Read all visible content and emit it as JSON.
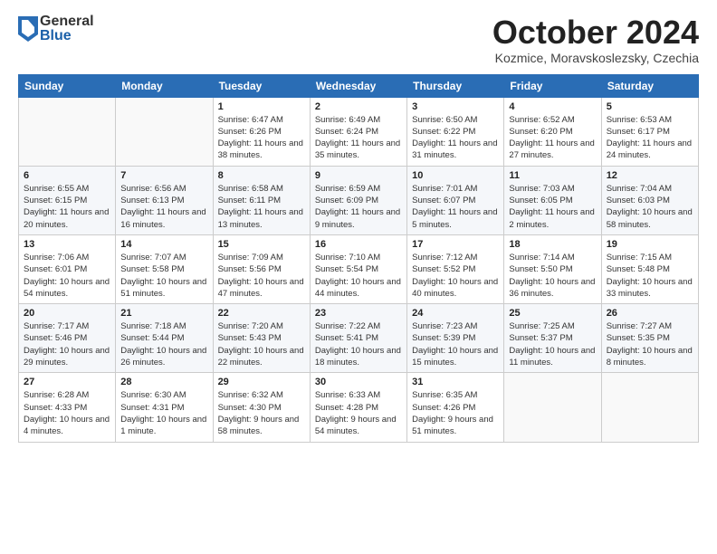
{
  "header": {
    "logo": {
      "general": "General",
      "blue": "Blue"
    },
    "title": "October 2024",
    "location": "Kozmice, Moravskoslezsky, Czechia"
  },
  "weekdays": [
    "Sunday",
    "Monday",
    "Tuesday",
    "Wednesday",
    "Thursday",
    "Friday",
    "Saturday"
  ],
  "weeks": [
    [
      {
        "day": "",
        "detail": ""
      },
      {
        "day": "",
        "detail": ""
      },
      {
        "day": "1",
        "detail": "Sunrise: 6:47 AM\nSunset: 6:26 PM\nDaylight: 11 hours and 38 minutes."
      },
      {
        "day": "2",
        "detail": "Sunrise: 6:49 AM\nSunset: 6:24 PM\nDaylight: 11 hours and 35 minutes."
      },
      {
        "day": "3",
        "detail": "Sunrise: 6:50 AM\nSunset: 6:22 PM\nDaylight: 11 hours and 31 minutes."
      },
      {
        "day": "4",
        "detail": "Sunrise: 6:52 AM\nSunset: 6:20 PM\nDaylight: 11 hours and 27 minutes."
      },
      {
        "day": "5",
        "detail": "Sunrise: 6:53 AM\nSunset: 6:17 PM\nDaylight: 11 hours and 24 minutes."
      }
    ],
    [
      {
        "day": "6",
        "detail": "Sunrise: 6:55 AM\nSunset: 6:15 PM\nDaylight: 11 hours and 20 minutes."
      },
      {
        "day": "7",
        "detail": "Sunrise: 6:56 AM\nSunset: 6:13 PM\nDaylight: 11 hours and 16 minutes."
      },
      {
        "day": "8",
        "detail": "Sunrise: 6:58 AM\nSunset: 6:11 PM\nDaylight: 11 hours and 13 minutes."
      },
      {
        "day": "9",
        "detail": "Sunrise: 6:59 AM\nSunset: 6:09 PM\nDaylight: 11 hours and 9 minutes."
      },
      {
        "day": "10",
        "detail": "Sunrise: 7:01 AM\nSunset: 6:07 PM\nDaylight: 11 hours and 5 minutes."
      },
      {
        "day": "11",
        "detail": "Sunrise: 7:03 AM\nSunset: 6:05 PM\nDaylight: 11 hours and 2 minutes."
      },
      {
        "day": "12",
        "detail": "Sunrise: 7:04 AM\nSunset: 6:03 PM\nDaylight: 10 hours and 58 minutes."
      }
    ],
    [
      {
        "day": "13",
        "detail": "Sunrise: 7:06 AM\nSunset: 6:01 PM\nDaylight: 10 hours and 54 minutes."
      },
      {
        "day": "14",
        "detail": "Sunrise: 7:07 AM\nSunset: 5:58 PM\nDaylight: 10 hours and 51 minutes."
      },
      {
        "day": "15",
        "detail": "Sunrise: 7:09 AM\nSunset: 5:56 PM\nDaylight: 10 hours and 47 minutes."
      },
      {
        "day": "16",
        "detail": "Sunrise: 7:10 AM\nSunset: 5:54 PM\nDaylight: 10 hours and 44 minutes."
      },
      {
        "day": "17",
        "detail": "Sunrise: 7:12 AM\nSunset: 5:52 PM\nDaylight: 10 hours and 40 minutes."
      },
      {
        "day": "18",
        "detail": "Sunrise: 7:14 AM\nSunset: 5:50 PM\nDaylight: 10 hours and 36 minutes."
      },
      {
        "day": "19",
        "detail": "Sunrise: 7:15 AM\nSunset: 5:48 PM\nDaylight: 10 hours and 33 minutes."
      }
    ],
    [
      {
        "day": "20",
        "detail": "Sunrise: 7:17 AM\nSunset: 5:46 PM\nDaylight: 10 hours and 29 minutes."
      },
      {
        "day": "21",
        "detail": "Sunrise: 7:18 AM\nSunset: 5:44 PM\nDaylight: 10 hours and 26 minutes."
      },
      {
        "day": "22",
        "detail": "Sunrise: 7:20 AM\nSunset: 5:43 PM\nDaylight: 10 hours and 22 minutes."
      },
      {
        "day": "23",
        "detail": "Sunrise: 7:22 AM\nSunset: 5:41 PM\nDaylight: 10 hours and 18 minutes."
      },
      {
        "day": "24",
        "detail": "Sunrise: 7:23 AM\nSunset: 5:39 PM\nDaylight: 10 hours and 15 minutes."
      },
      {
        "day": "25",
        "detail": "Sunrise: 7:25 AM\nSunset: 5:37 PM\nDaylight: 10 hours and 11 minutes."
      },
      {
        "day": "26",
        "detail": "Sunrise: 7:27 AM\nSunset: 5:35 PM\nDaylight: 10 hours and 8 minutes."
      }
    ],
    [
      {
        "day": "27",
        "detail": "Sunrise: 6:28 AM\nSunset: 4:33 PM\nDaylight: 10 hours and 4 minutes."
      },
      {
        "day": "28",
        "detail": "Sunrise: 6:30 AM\nSunset: 4:31 PM\nDaylight: 10 hours and 1 minute."
      },
      {
        "day": "29",
        "detail": "Sunrise: 6:32 AM\nSunset: 4:30 PM\nDaylight: 9 hours and 58 minutes."
      },
      {
        "day": "30",
        "detail": "Sunrise: 6:33 AM\nSunset: 4:28 PM\nDaylight: 9 hours and 54 minutes."
      },
      {
        "day": "31",
        "detail": "Sunrise: 6:35 AM\nSunset: 4:26 PM\nDaylight: 9 hours and 51 minutes."
      },
      {
        "day": "",
        "detail": ""
      },
      {
        "day": "",
        "detail": ""
      }
    ]
  ]
}
